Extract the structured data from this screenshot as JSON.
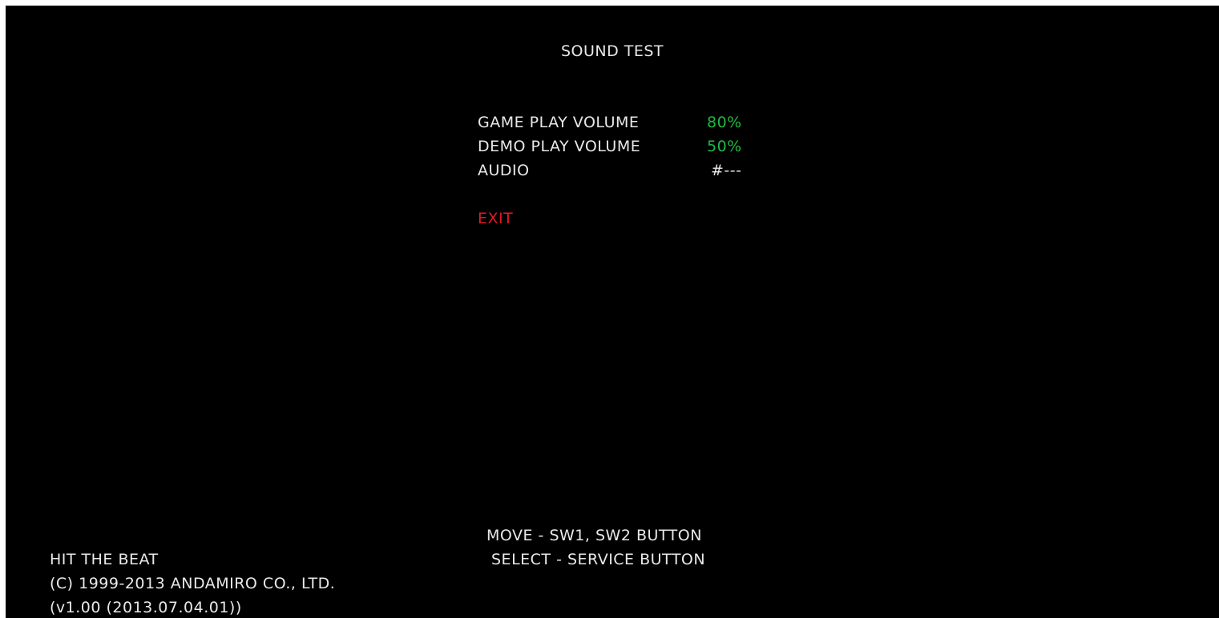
{
  "screen": {
    "title": "SOUND TEST",
    "menu": [
      {
        "label": "GAME PLAY VOLUME",
        "value": "80%"
      },
      {
        "label": "DEMO PLAY VOLUME",
        "value": "50%"
      },
      {
        "label": "AUDIO",
        "value": "#---"
      }
    ],
    "exit_label": "EXIT",
    "help": {
      "move": "MOVE - SW1, SW2 BUTTON",
      "select": "SELECT - SERVICE BUTTON"
    },
    "footer": {
      "game_title": "HIT THE BEAT",
      "copyright": "(C) 1999-2013 ANDAMIRO CO., LTD.",
      "version": "(v1.00 (2013.07.04.01))"
    }
  },
  "colors": {
    "background": "#000000",
    "text": "#e8e8e8",
    "value_green": "#1fb843",
    "exit_red": "#e01b24"
  }
}
